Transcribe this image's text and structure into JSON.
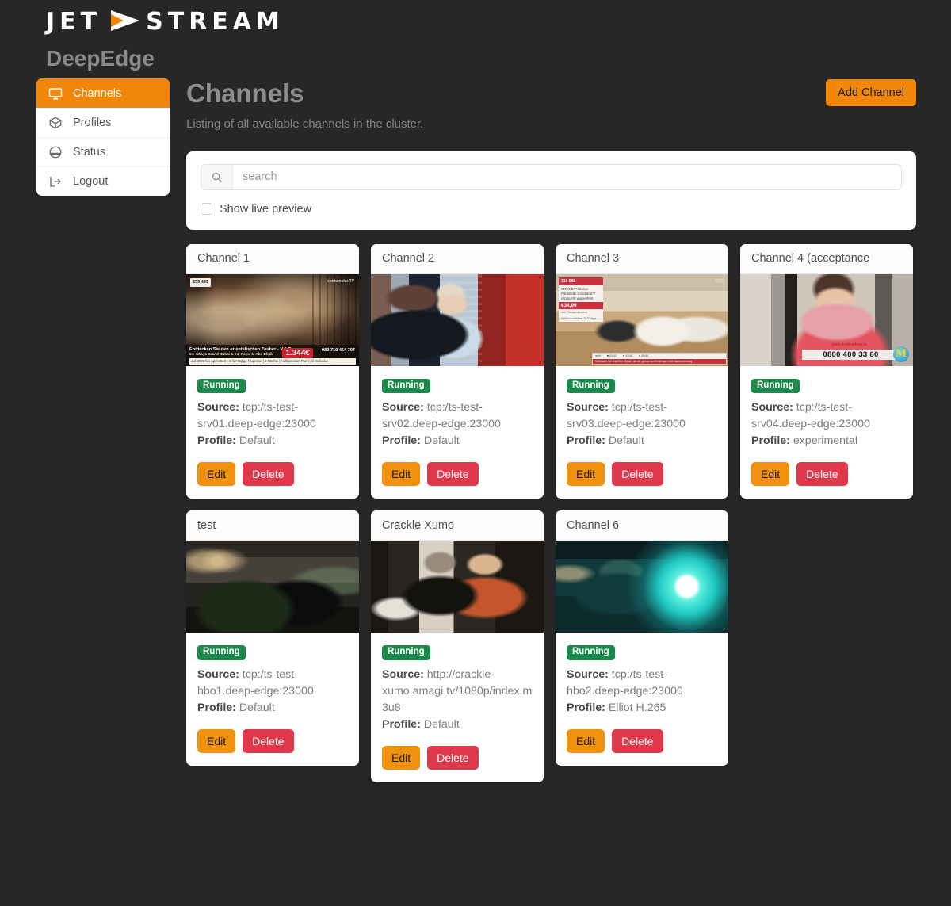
{
  "brand": {
    "logo_text_left": "JET",
    "logo_text_right": "STREAM",
    "logo_icon": "play-arrow-icon",
    "product": "DeepEdge"
  },
  "sidebar": {
    "items": [
      {
        "label": "Channels",
        "icon": "monitor-icon",
        "active": true
      },
      {
        "label": "Profiles",
        "icon": "box-icon",
        "active": false
      },
      {
        "label": "Status",
        "icon": "gauge-icon",
        "active": false
      },
      {
        "label": "Logout",
        "icon": "logout-icon",
        "active": false
      }
    ]
  },
  "header": {
    "title": "Channels",
    "subtitle": "Listing of all available channels in the cluster.",
    "add_button": "Add Channel"
  },
  "search": {
    "placeholder": "search",
    "value": "",
    "icon": "search-icon",
    "live_preview_label": "Show live preview",
    "live_preview_checked": false
  },
  "labels": {
    "source": "Source:",
    "profile": "Profile:",
    "edit": "Edit",
    "delete": "Delete"
  },
  "colors": {
    "page_bg": "#272727",
    "accent": "#f0860a",
    "edit": "#f0920f",
    "delete": "#e0384b",
    "running": "#198a4b",
    "card_bg": "#ffffff",
    "title_gray": "#8d8d8d"
  },
  "channels": [
    {
      "name": "Channel 1",
      "status": "Running",
      "source": "tcp:/ts-test-srv01.deep-edge:23000",
      "profile": "Default",
      "thumb": "hotel-lobby-travel-ad",
      "thumb_overlay": {
        "headline": "Entdecken Sie den orientalischen Zauber - V.A.E.",
        "subline": "5★ Ghaya Grand Dubai & 5★ Royal M Abu Dhabi",
        "strip": "Juli 2023 bis April 2024 | 9-/10-tägige Flugreise | 8 Nächte | Halbpension Plus | All Inclusive",
        "price": "1.344€",
        "phone": "089 710 454 707",
        "corner": "239 443",
        "logo": "sonnenklar.TV"
      }
    },
    {
      "name": "Channel 2",
      "status": "Running",
      "source": "tcp:/ts-test-srv02.deep-edge:23000",
      "profile": "Default",
      "thumb": "two-people-at-red-train-door"
    },
    {
      "name": "Channel 3",
      "status": "Running",
      "source": "tcp:/ts-test-srv03.deep-edge:23000",
      "profile": "Default",
      "thumb": "teleshopping-sandals",
      "thumb_overlay": {
        "card_head": "319  008",
        "card_text": "CROCS™ Unisex-Pantolette Crocband™ ultraleicht wasserfest",
        "price": "€34,99",
        "card_sub": "inkl. Versandkosten",
        "card_sub2": "Größen wählbar QVC App",
        "bar_text": "Verbinden Sie bitte Ihre Größe, die die gewuenschte Menge in der Aufbewahrung"
      }
    },
    {
      "name": "Channel 4 (acceptance",
      "status": "Running",
      "source": "tcp:/ts-test-srv04.deep-edge:23000",
      "profile": "experimental",
      "thumb": "woman-in-kitchen-teleshopping",
      "thumb_overlay": {
        "phone": "0800 400 33 60",
        "url": "www.mediashop.tv",
        "logo": "M"
      }
    },
    {
      "name": "test",
      "status": "Running",
      "source": "tcp:/ts-test-hbo1.deep-edge:23000",
      "profile": "Default",
      "thumb": "night-street-hotel-entrance"
    },
    {
      "name": "Crackle Xumo",
      "status": "Running",
      "source": "http://crackle-xumo.amagi.tv/1080p/index.m3u8",
      "profile": "Default",
      "thumb": "man-and-woman-in-office"
    },
    {
      "name": "Channel 6",
      "status": "Running",
      "source": "tcp:/ts-test-hbo2.deep-edge:23000",
      "profile": "Elliot H.265",
      "thumb": "dark-teal-car-scene"
    }
  ]
}
